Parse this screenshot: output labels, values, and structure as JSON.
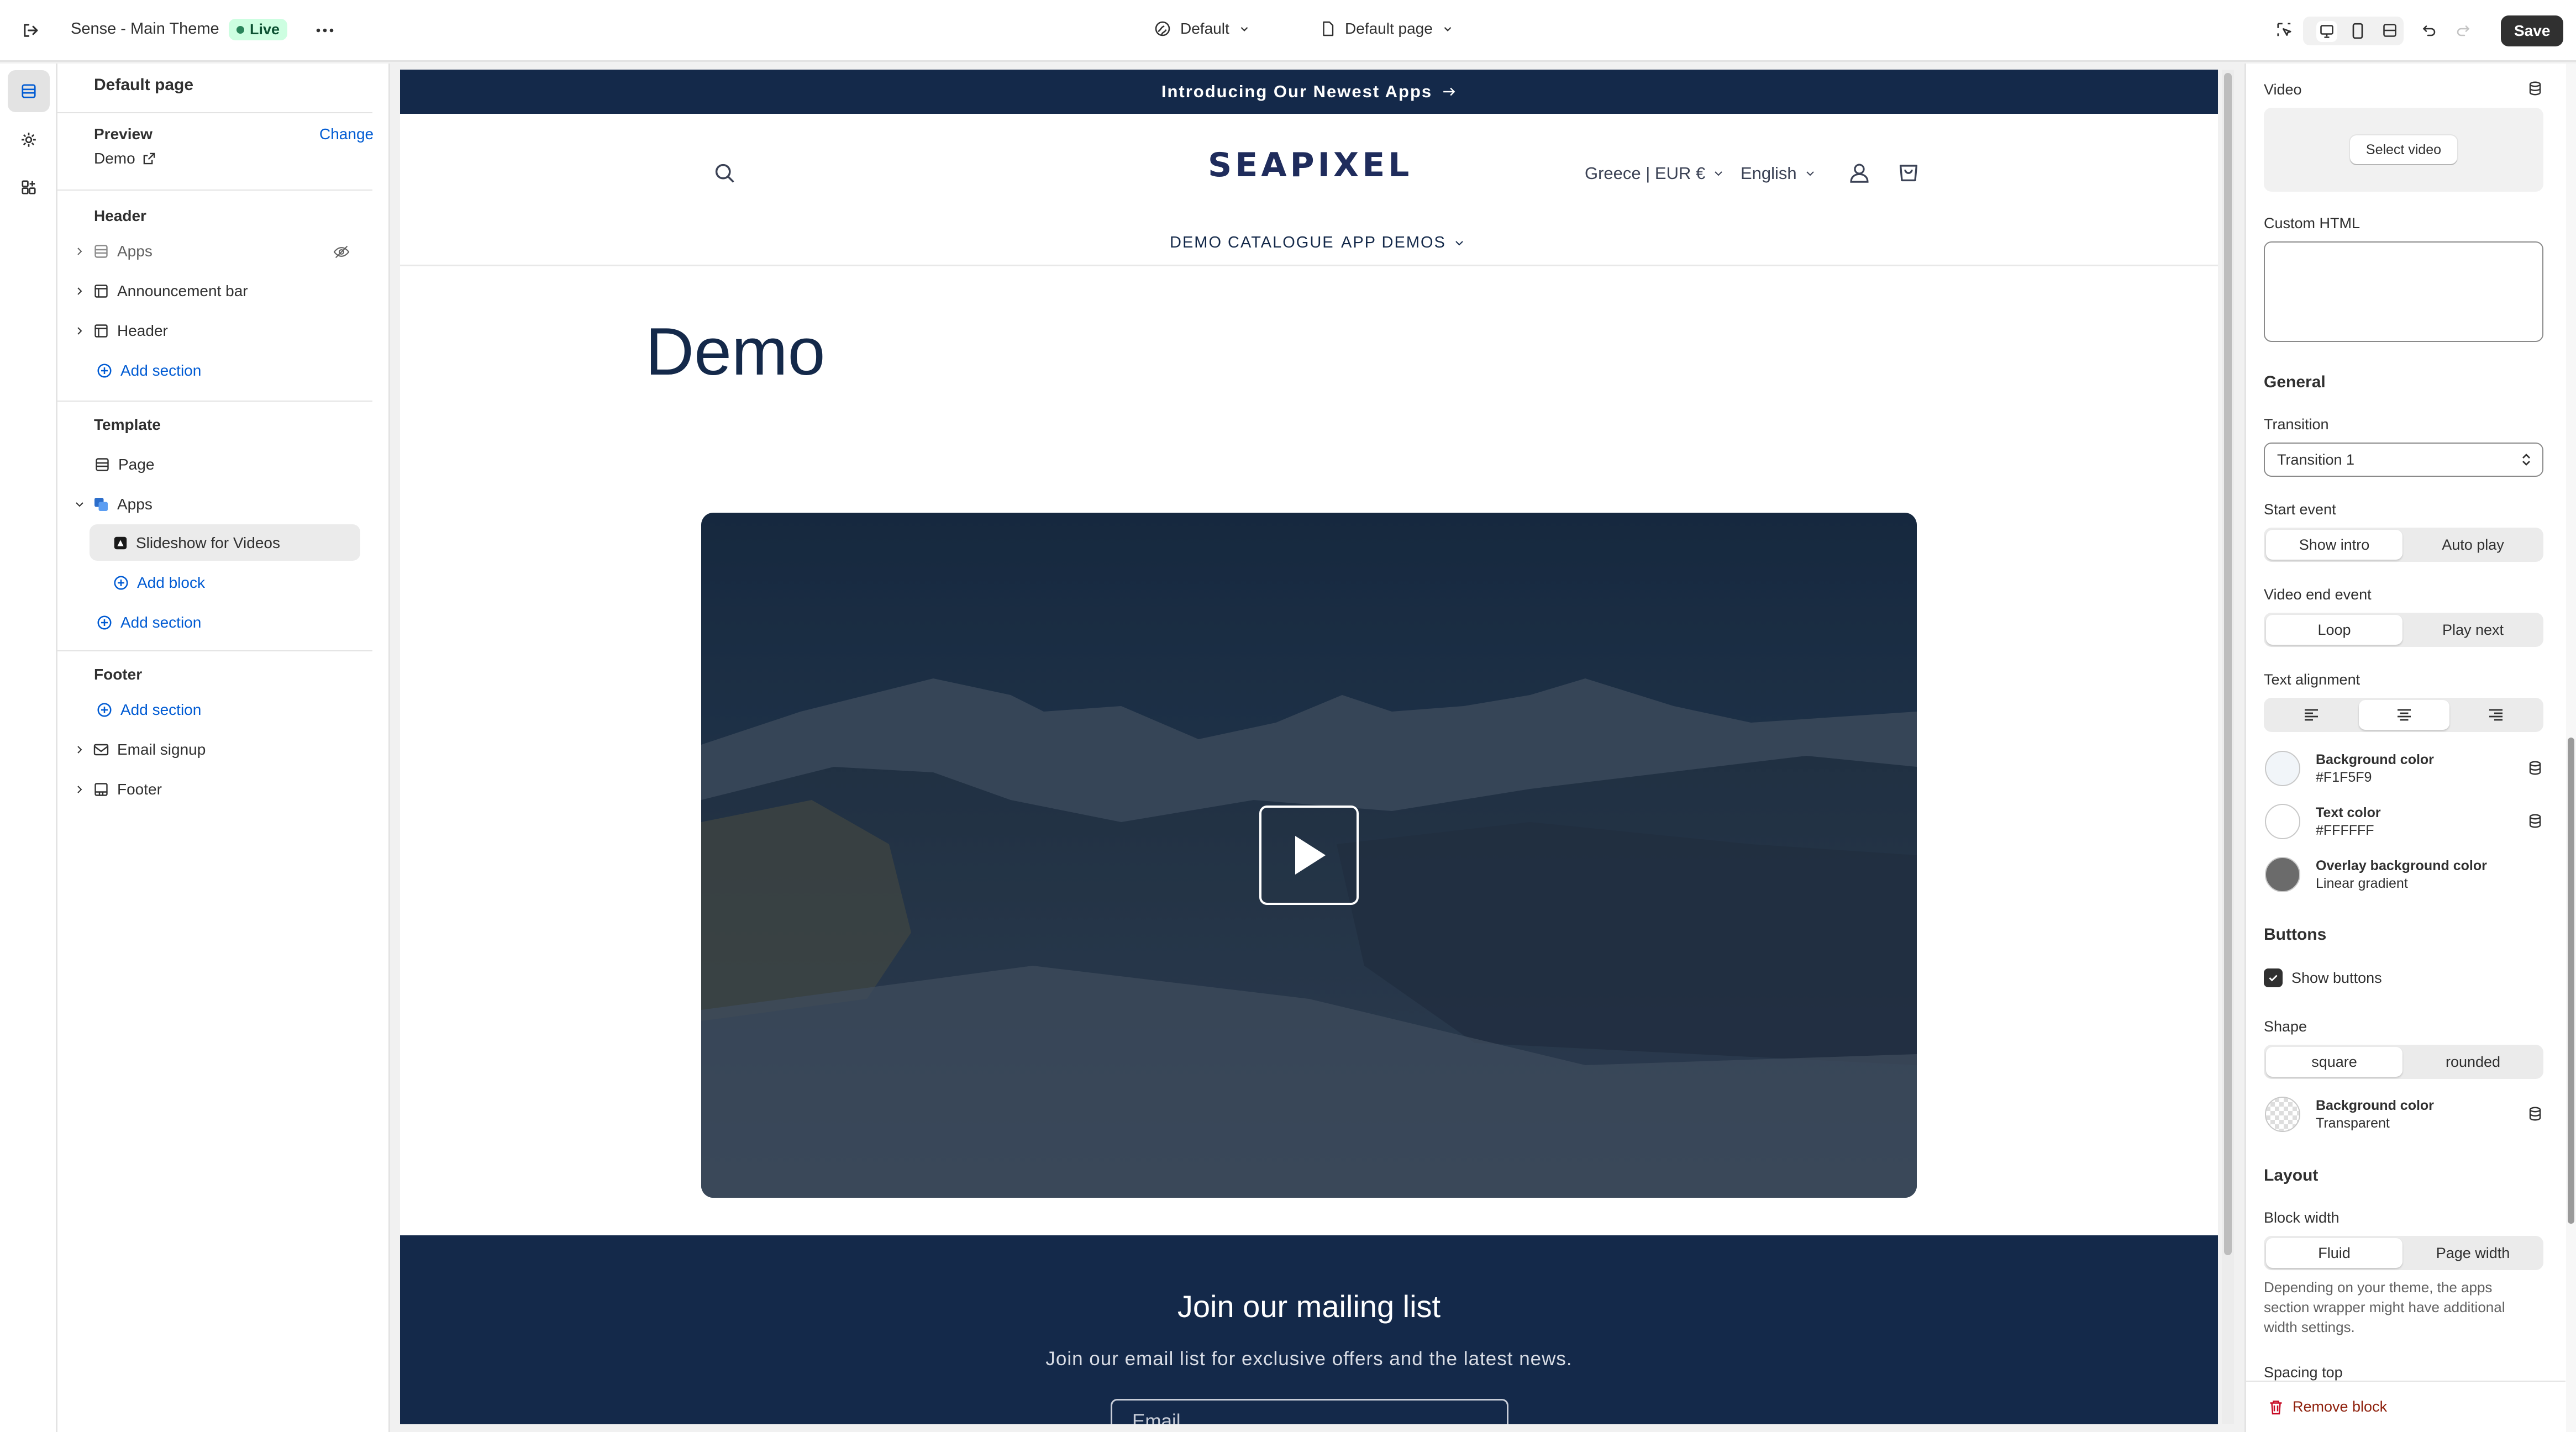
{
  "topbar": {
    "theme_name": "Sense - Main Theme",
    "live_label": "Live",
    "default_selector": "Default",
    "page_selector": "Default page",
    "save_label": "Save"
  },
  "left_panel": {
    "title": "Default page",
    "preview_label": "Preview",
    "change_label": "Change",
    "preview_value": "Demo",
    "header_heading": "Header",
    "header_items": [
      "Apps",
      "Announcement bar",
      "Header"
    ],
    "add_section": "Add section",
    "template_heading": "Template",
    "template_items": [
      "Page",
      "Apps"
    ],
    "selected_block": "Slideshow for Videos",
    "add_block": "Add block",
    "footer_heading": "Footer",
    "footer_items": [
      "Email signup",
      "Footer"
    ]
  },
  "site": {
    "announcement": "Introducing Our Newest Apps",
    "logo": "SEAPIXEL",
    "country": "Greece | EUR €",
    "language": "English",
    "nav": [
      "DEMO CATALOGUE",
      "APP DEMOS"
    ],
    "page_title": "Demo",
    "mailing_title": "Join our mailing list",
    "mailing_subtitle": "Join our email list for exclusive offers and the latest news.",
    "email_placeholder": "Email"
  },
  "right_panel": {
    "video_label": "Video",
    "select_video": "Select video",
    "custom_html_label": "Custom HTML",
    "general_heading": "General",
    "transition_label": "Transition",
    "transition_value": "Transition 1",
    "start_event_label": "Start event",
    "start_event_options": [
      "Show intro",
      "Auto play"
    ],
    "video_end_label": "Video end event",
    "video_end_options": [
      "Loop",
      "Play next"
    ],
    "text_alignment_label": "Text alignment",
    "colors": [
      {
        "title": "Background color",
        "value": "#F1F5F9",
        "swatch": "#F1F5F9"
      },
      {
        "title": "Text color",
        "value": "#FFFFFF",
        "swatch": "#FFFFFF"
      },
      {
        "title": "Overlay background color",
        "value": "Linear gradient",
        "swatch": "#6b6b6b"
      }
    ],
    "buttons_heading": "Buttons",
    "show_buttons": "Show buttons",
    "shape_label": "Shape",
    "shape_options": [
      "square",
      "rounded"
    ],
    "button_bg_title": "Background color",
    "button_bg_value": "Transparent",
    "layout_heading": "Layout",
    "block_width_label": "Block width",
    "block_width_options": [
      "Fluid",
      "Page width"
    ],
    "block_width_help": [
      "Depending on your theme, the apps",
      "section wrapper might have additional",
      "width settings."
    ],
    "spacing_top_label": "Spacing top",
    "remove_block": "Remove block"
  }
}
